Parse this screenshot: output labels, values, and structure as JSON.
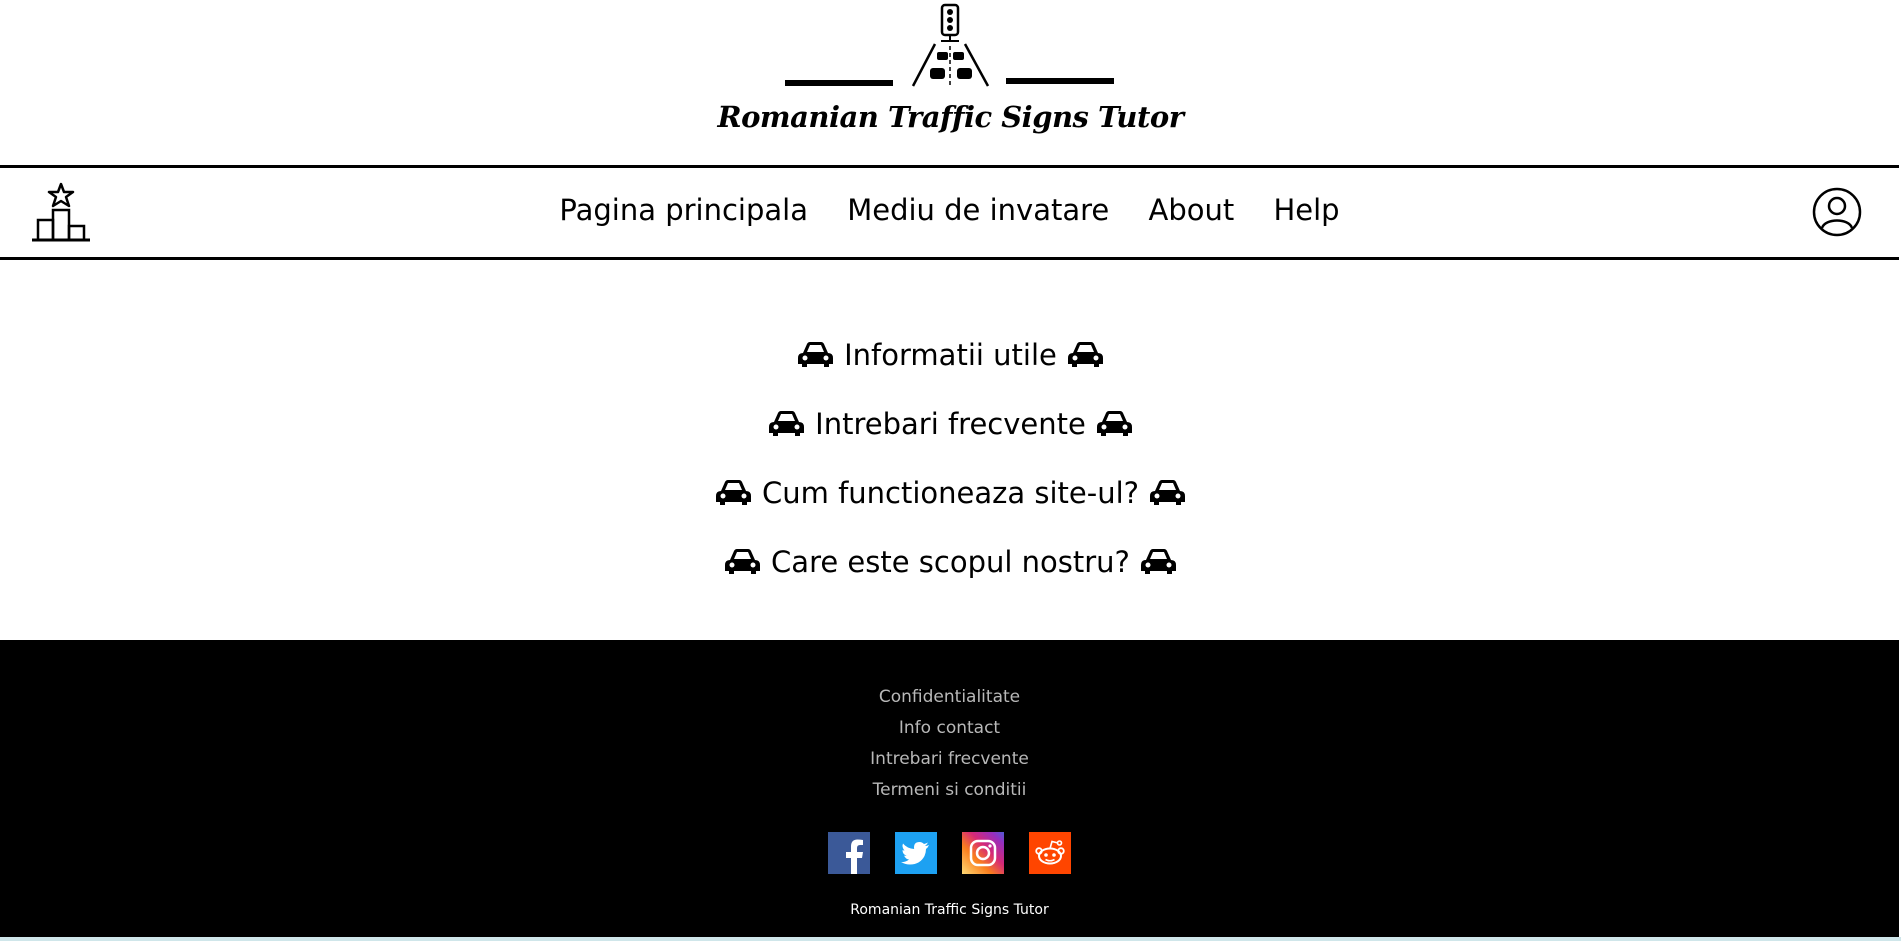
{
  "header": {
    "logo_icon": "traffic-road-logo",
    "title": "Romanian Traffic Signs Tutor"
  },
  "navbar": {
    "leaderboard_icon": "podium-star-icon",
    "links": [
      {
        "label": "Pagina principala"
      },
      {
        "label": "Mediu de invatare"
      },
      {
        "label": "About"
      },
      {
        "label": "Help"
      }
    ],
    "user_icon": "user-profile-icon"
  },
  "main": {
    "item_icon": "car-icon",
    "items": [
      {
        "label": "Informatii utile"
      },
      {
        "label": "Intrebari frecvente"
      },
      {
        "label": "Cum functioneaza site-ul?"
      },
      {
        "label": "Care este scopul nostru?"
      }
    ]
  },
  "footer": {
    "links": [
      {
        "label": "Confidentialitate"
      },
      {
        "label": "Info contact"
      },
      {
        "label": "Intrebari frecvente"
      },
      {
        "label": "Termeni si conditii"
      }
    ],
    "social": [
      {
        "name": "facebook-icon",
        "color": "#3b5998"
      },
      {
        "name": "twitter-icon",
        "color": "#1da1f2"
      },
      {
        "name": "instagram-icon",
        "color": "#c13584"
      },
      {
        "name": "reddit-icon",
        "color": "#ff4500"
      }
    ],
    "copyright": "Romanian Traffic Signs Tutor"
  },
  "colors": {
    "background": "#ffffff",
    "footer_bg": "#000000",
    "footer_link": "#b8b8b8",
    "bottom_strip": "#cfe6ea"
  }
}
